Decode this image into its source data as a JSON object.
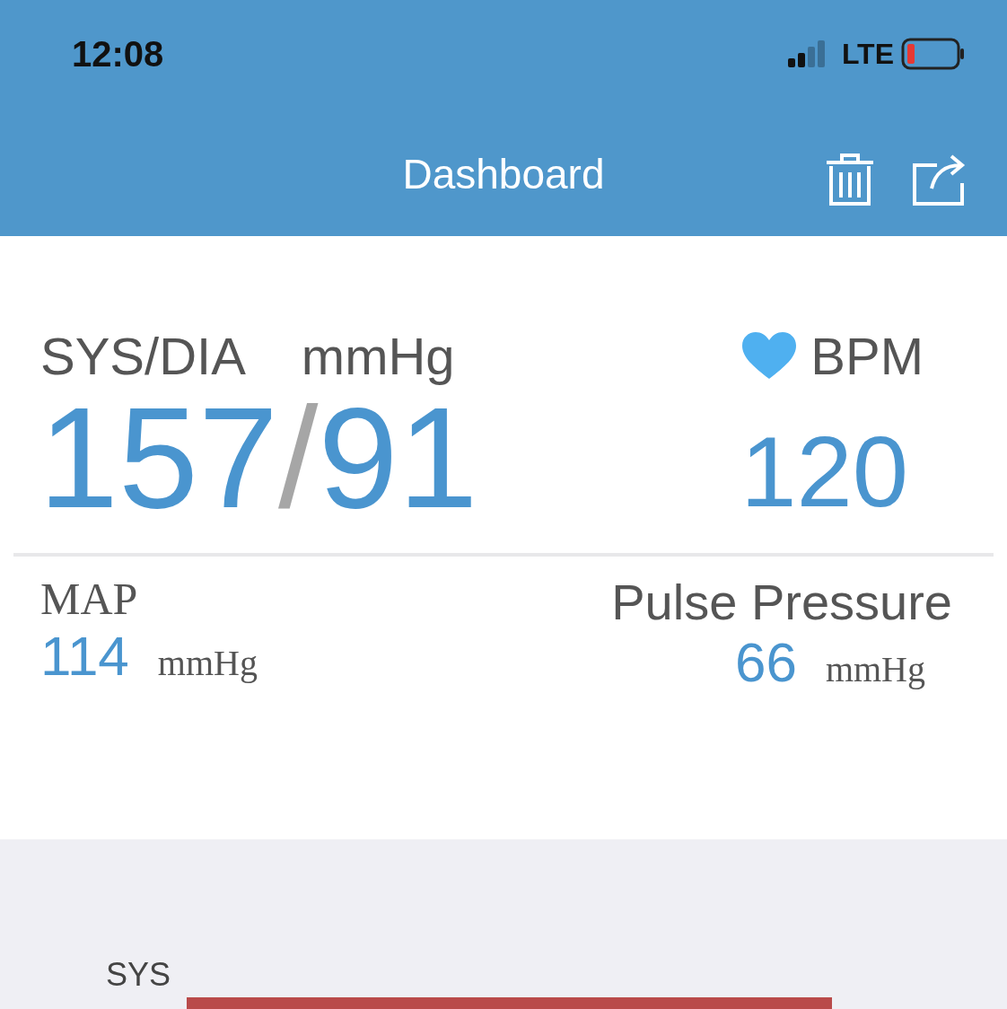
{
  "status_bar": {
    "time": "12:08",
    "network": "LTE"
  },
  "nav_bar": {
    "title": "Dashboard"
  },
  "reading": {
    "pressure_label": "SYS/DIA",
    "pressure_unit": "mmHg",
    "pulse_label": "BPM",
    "systolic": "157",
    "separator": "/",
    "diastolic": "91",
    "pulse": "120"
  },
  "derived": [
    {
      "label": "MAP",
      "value": "114",
      "unit": "mmHg"
    },
    {
      "label": "Pulse Pressure",
      "value": "66",
      "unit": "mmHg"
    }
  ],
  "chart": {
    "label": "SYS"
  }
}
